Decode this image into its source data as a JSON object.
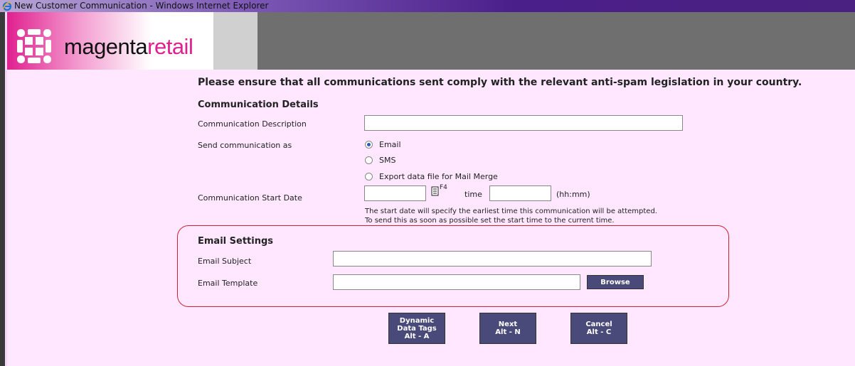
{
  "window": {
    "title": "New Customer Communication - Windows Internet Explorer"
  },
  "brand": {
    "name_part1": "magenta",
    "name_part2": "retail"
  },
  "notice": "Please ensure that all communications sent comply with the relevant anti-spam legislation in your country.",
  "details": {
    "title": "Communication Details",
    "description_label": "Communication Description",
    "description_value": "",
    "send_as_label": "Send communication as",
    "send_options": [
      {
        "label": "Email",
        "checked": true
      },
      {
        "label": "SMS",
        "checked": false
      },
      {
        "label": "Export data file for Mail Merge",
        "checked": false
      }
    ],
    "start_date_label": "Communication Start Date",
    "start_date_value": "",
    "calendar_hint": "F4",
    "time_label": "time",
    "time_value": "",
    "time_format": "(hh:mm)",
    "hint_line1": "The start date will specify the earliest time this communication will be attempted.",
    "hint_line2": "To send this as soon as possible set the start time to the current time."
  },
  "email": {
    "title": "Email Settings",
    "subject_label": "Email Subject",
    "subject_value": "",
    "template_label": "Email Template",
    "template_value": "",
    "browse_label": "Browse"
  },
  "actions": {
    "dynamic_line1": "Dynamic",
    "dynamic_line2": "Data Tags",
    "dynamic_line3": "Alt - A",
    "next_line1": "Next",
    "next_line2": "Alt - N",
    "cancel_line1": "Cancel",
    "cancel_line2": "Alt - C"
  },
  "colors": {
    "accent": "#e0208e",
    "button": "#4a4a7a",
    "page_bg": "#ffe8ff",
    "outline": "#d02030"
  }
}
